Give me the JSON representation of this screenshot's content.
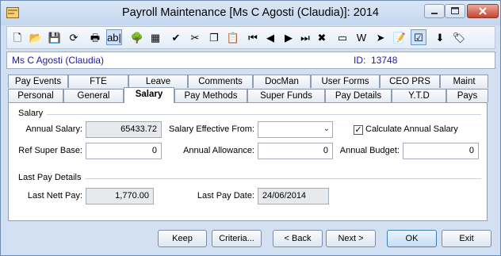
{
  "window": {
    "title": "Payroll Maintenance  [Ms C Agosti (Claudia)]:  2014"
  },
  "toolbar": {
    "buttons": [
      {
        "name": "new-icon",
        "glyph": "🗋"
      },
      {
        "name": "open-folder-icon",
        "glyph": "📂"
      },
      {
        "name": "save-icon",
        "glyph": "💾"
      },
      {
        "name": "refresh-icon",
        "glyph": "⟳"
      },
      {
        "name": "print-icon",
        "glyph": "🖶"
      },
      {
        "name": "text-field-icon",
        "glyph": "ab|"
      },
      {
        "name": "tree-icon",
        "glyph": "🌳"
      },
      {
        "name": "calculator-icon",
        "glyph": "▦"
      },
      {
        "name": "spell-check-icon",
        "glyph": "✔"
      },
      {
        "name": "cut-icon",
        "glyph": "✂"
      },
      {
        "name": "copy-icon",
        "glyph": "❐"
      },
      {
        "name": "paste-icon",
        "glyph": "📋"
      },
      {
        "name": "first-record-icon",
        "glyph": "⏮"
      },
      {
        "name": "previous-record-icon",
        "glyph": "◀"
      },
      {
        "name": "next-record-icon",
        "glyph": "▶"
      },
      {
        "name": "last-record-icon",
        "glyph": "⏭"
      },
      {
        "name": "delete-icon",
        "glyph": "✖"
      },
      {
        "name": "card-icon",
        "glyph": "▭"
      },
      {
        "name": "word-document-icon",
        "glyph": "W"
      },
      {
        "name": "send-icon",
        "glyph": "➤"
      },
      {
        "name": "clipboard-edit-icon",
        "glyph": "📝"
      },
      {
        "name": "approve-icon",
        "glyph": "☑"
      },
      {
        "name": "download-icon",
        "glyph": "⬇"
      },
      {
        "name": "tag-icon",
        "glyph": "🏷"
      }
    ]
  },
  "employee": {
    "name": "Ms C Agosti (Claudia)",
    "id_label": "ID:",
    "id": "13748"
  },
  "tabs": {
    "row1": [
      "Pay Events",
      "FTE",
      "Leave",
      "Comments",
      "DocMan",
      "User Forms",
      "CEO PRS",
      "Maint"
    ],
    "row2": [
      "Personal",
      "General",
      "Salary",
      "Pay Methods",
      "Super Funds",
      "Pay Details",
      "Y.T.D",
      "Pays"
    ],
    "selected": "Salary"
  },
  "salary": {
    "group_label": "Salary",
    "annual_salary_label": "Annual Salary:",
    "annual_salary": "65433.72",
    "salary_effective_from_label": "Salary Effective From:",
    "salary_effective_from": "",
    "calculate_annual_salary_label": "Calculate Annual Salary",
    "calculate_annual_salary_checked": true,
    "ref_super_base_label": "Ref Super Base:",
    "ref_super_base": "0",
    "annual_allowance_label": "Annual Allowance:",
    "annual_allowance": "0",
    "annual_budget_label": "Annual Budget:",
    "annual_budget": "0"
  },
  "last_pay": {
    "group_label": "Last Pay Details",
    "last_nett_pay_label": "Last Nett Pay:",
    "last_nett_pay": "1,770.00",
    "last_pay_date_label": "Last Pay Date:",
    "last_pay_date": "24/06/2014"
  },
  "buttons": {
    "keep": "Keep",
    "criteria": "Criteria...",
    "back": "< Back",
    "next": "Next >",
    "ok": "OK",
    "exit": "Exit"
  }
}
